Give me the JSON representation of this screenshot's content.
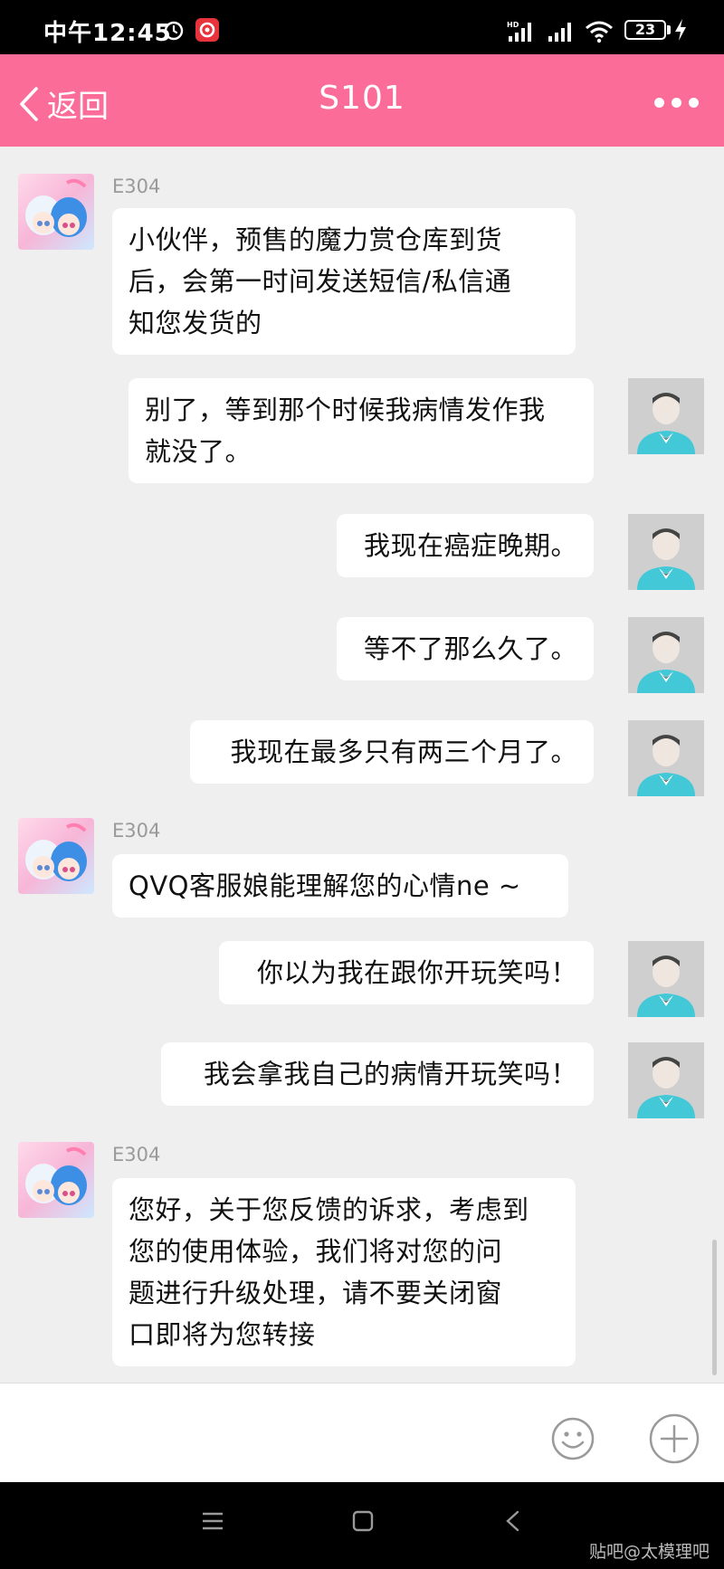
{
  "status_bar": {
    "time": "中午12:45",
    "battery": "23",
    "signal_label": "HD"
  },
  "header": {
    "back_label": "返回",
    "title": "S101"
  },
  "messages": [
    {
      "sender": "E304",
      "side": "left",
      "lines": [
        "小伙伴，预售的魔力赏仓库到货",
        "后，会第一时间发送短信/私信通",
        "知您发货的"
      ]
    },
    {
      "side": "right",
      "lines": [
        "别了，等到那个时候我病情发作我",
        "就没了。"
      ]
    },
    {
      "side": "right",
      "lines": [
        "我现在癌症晚期。"
      ]
    },
    {
      "side": "right",
      "lines": [
        "等不了那么久了。"
      ]
    },
    {
      "side": "right",
      "lines": [
        "我现在最多只有两三个月了。"
      ]
    },
    {
      "sender": "E304",
      "side": "left",
      "lines": [
        "QVQ客服娘能理解您的心情ne ~"
      ]
    },
    {
      "side": "right",
      "lines": [
        "你以为我在跟你开玩笑吗！"
      ]
    },
    {
      "side": "right",
      "lines": [
        "我会拿我自己的病情开玩笑吗！"
      ]
    },
    {
      "sender": "E304",
      "side": "left",
      "lines": [
        "您好，关于您反馈的诉求，考虑到",
        "您的使用体验，我们将对您的问",
        "题进行升级处理，请不要关闭窗",
        "口即将为您转接"
      ]
    }
  ],
  "watermark": "贴吧@太模理吧",
  "colors": {
    "header_bg": "#fc6c98",
    "chat_bg": "#efefef",
    "bubble_bg": "#ffffff"
  },
  "icons": {
    "back": "chevron-left-icon",
    "more": "more-dots-icon",
    "emoji": "smiley-icon",
    "plus": "plus-circle-icon",
    "menu": "menu-icon",
    "home": "square-home-icon",
    "nav_back": "triangle-back-icon"
  }
}
